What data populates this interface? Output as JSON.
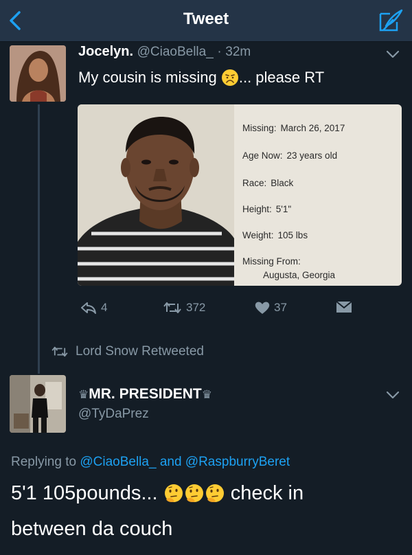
{
  "header": {
    "title": "Tweet"
  },
  "tweet": {
    "author_name": "Jocelyn.",
    "author_handle": "@CiaoBella_",
    "time_sep": "·",
    "time": "32m",
    "text_before_emoji": "My cousin is missing",
    "text_after_emoji": "... please RT",
    "emoji": "disappointed-face",
    "media": {
      "missing_label": "Missing:",
      "missing_value": "March 26, 2017",
      "age_label": "Age Now:",
      "age_value": "23 years old",
      "race_label": "Race:",
      "race_value": "Black",
      "height_label": "Height:",
      "height_value": "5'1\"",
      "weight_label": "Weight:",
      "weight_value": "105 lbs",
      "from_label": "Missing From:",
      "from_value": "Augusta, Georgia"
    },
    "actions": {
      "reply_count": "4",
      "retweet_count": "372",
      "like_count": "37"
    }
  },
  "retweet_notice": {
    "text": "Lord Snow Retweeted"
  },
  "reply_tweet": {
    "author_name": "MR. PRESIDENT",
    "crown_symbol": "♛",
    "author_handle": "@TyDaPrez",
    "replying_to_label": "Replying to",
    "replying_to_user1": "@CiaoBella_",
    "replying_to_and": "and",
    "replying_to_user2": "@RaspburryBeret",
    "text_line1_before": "5'1 105pounds...",
    "text_line1_after": "check in",
    "text_line2": "between da couch",
    "emoji": "thinking-face"
  },
  "colors": {
    "background": "#141d26",
    "header": "#243447",
    "secondary_text": "#8899a6",
    "link": "#1da1f2"
  }
}
